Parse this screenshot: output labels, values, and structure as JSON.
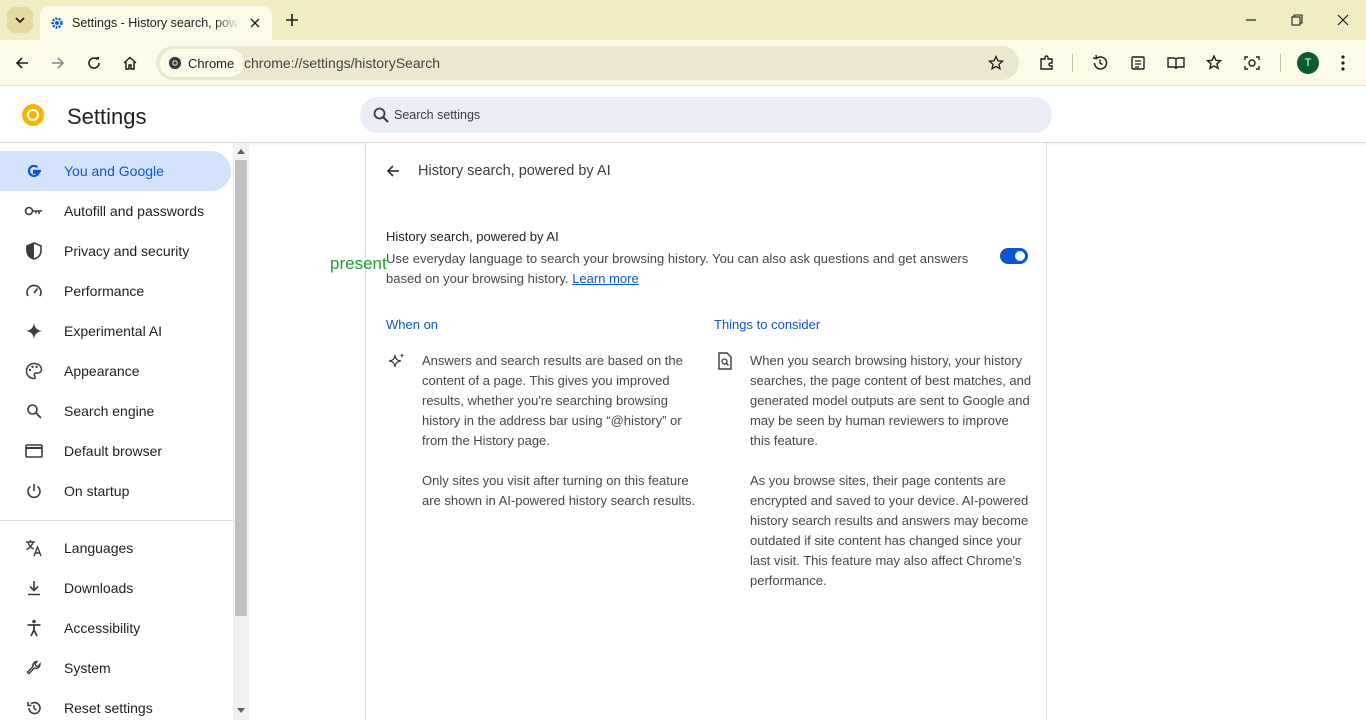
{
  "tab": {
    "title": "Settings - History search, powered by AI"
  },
  "toolbar": {
    "chip_label": "Chrome",
    "url": "chrome://settings/historySearch",
    "avatar_initial": "T"
  },
  "header": {
    "title": "Settings",
    "search_placeholder": "Search settings"
  },
  "sidebar": {
    "items": [
      {
        "label": "You and Google",
        "icon": "google-g-icon"
      },
      {
        "label": "Autofill and passwords",
        "icon": "key-icon"
      },
      {
        "label": "Privacy and security",
        "icon": "shield-icon"
      },
      {
        "label": "Performance",
        "icon": "speedometer-icon"
      },
      {
        "label": "Experimental AI",
        "icon": "sparkle-icon"
      },
      {
        "label": "Appearance",
        "icon": "palette-icon"
      },
      {
        "label": "Search engine",
        "icon": "search-icon"
      },
      {
        "label": "Default browser",
        "icon": "browser-window-icon"
      },
      {
        "label": "On startup",
        "icon": "power-icon"
      },
      {
        "label": "Languages",
        "icon": "translate-icon"
      },
      {
        "label": "Downloads",
        "icon": "download-icon"
      },
      {
        "label": "Accessibility",
        "icon": "accessibility-icon"
      },
      {
        "label": "System",
        "icon": "wrench-icon"
      },
      {
        "label": "Reset settings",
        "icon": "reset-icon"
      }
    ]
  },
  "main": {
    "page_title": "History search, powered by AI",
    "feature_title": "History search, powered by AI",
    "feature_desc": "Use everyday language to search your browsing history. You can also ask questions and get answers based on your browsing history.",
    "learn_more": "Learn more",
    "toggle_on": true,
    "when_on": {
      "heading": "When on",
      "para1": "Answers and search results are based on the content of a page. This gives you improved results, whether you're searching browsing history in the address bar using “@history” or from the History page.",
      "para2": "Only sites you visit after turning on this feature are shown in AI-powered history search results."
    },
    "consider": {
      "heading": "Things to consider",
      "para1": "When you search browsing history, your history searches, the page content of best matches, and generated model outputs are sent to Google and may be seen by human reviewers to improve this feature.",
      "para2": "As you browse sites, their page contents are encrypted and saved to your device. AI-powered history search results and answers may become outdated if site content has changed since your last visit. This feature may also affect Chrome's performance."
    }
  },
  "overlay": {
    "text": "present"
  },
  "colors": {
    "accent": "#0b57d0",
    "active_bg": "#d3e3fd",
    "frame": "#f1ecc4",
    "overlay": "#1e9e2e"
  }
}
